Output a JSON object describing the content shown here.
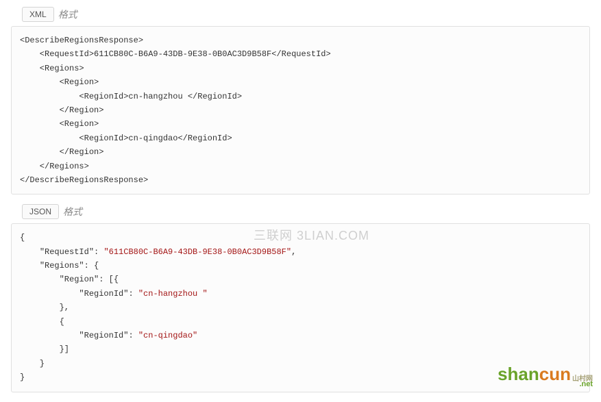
{
  "xml_section": {
    "button_label": "XML",
    "format_label": "格式",
    "content": "<DescribeRegionsResponse>\n    <RequestId>611CB80C-B6A9-43DB-9E38-0B0AC3D9B58F</RequestId>\n    <Regions>\n        <Region>\n            <RegionId>cn-hangzhou </RegionId>\n        </Region>\n        <Region>\n            <RegionId>cn-qingdao</RegionId>\n        </Region>\n    </Regions>\n</DescribeRegionsResponse>"
  },
  "json_section": {
    "button_label": "JSON",
    "format_label": "格式",
    "keys": {
      "requestId": "\"RequestId\"",
      "regions": "\"Regions\"",
      "region": "\"Region\"",
      "regionId": "\"RegionId\""
    },
    "values": {
      "requestId": "\"611CB80C-B6A9-43DB-9E38-0B0AC3D9B58F\"",
      "hangzhou": "\"cn-hangzhou \"",
      "qingdao": "\"cn-qingdao\""
    }
  },
  "watermark_text": "三联网 3LIAN.COM",
  "logo": {
    "shan": "shan",
    "cun": "cun",
    "sub": "山村网",
    "net": ".net"
  }
}
